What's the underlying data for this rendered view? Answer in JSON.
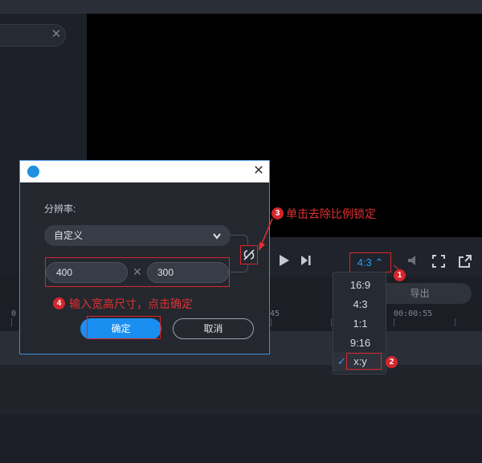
{
  "player": {
    "ratio_label": "4:3 ⌃",
    "export_label": "导出",
    "timestamps": [
      "0",
      "00:00:45",
      "00:00:55"
    ]
  },
  "ratio_menu": {
    "items": [
      "16:9",
      "4:3",
      "1:1",
      "9:16",
      "x:y"
    ],
    "selected": "x:y",
    "check": "✓"
  },
  "dialog": {
    "res_label": "分辨率:",
    "preset": "自定义",
    "width": "400",
    "height": "300",
    "times": "✕",
    "ok_label": "确定",
    "cancel_label": "取消",
    "close": "✕"
  },
  "annotations": {
    "n1": "1",
    "n2": "2",
    "n3": "3",
    "n4": "4",
    "step3": "单击去除比例锁定",
    "step4": "输入宽高尺寸，点击确定"
  },
  "colors": {
    "accent": "#1b8ff1",
    "annotation_red": "#d9262b",
    "dialog_border": "#3d8fd8"
  }
}
